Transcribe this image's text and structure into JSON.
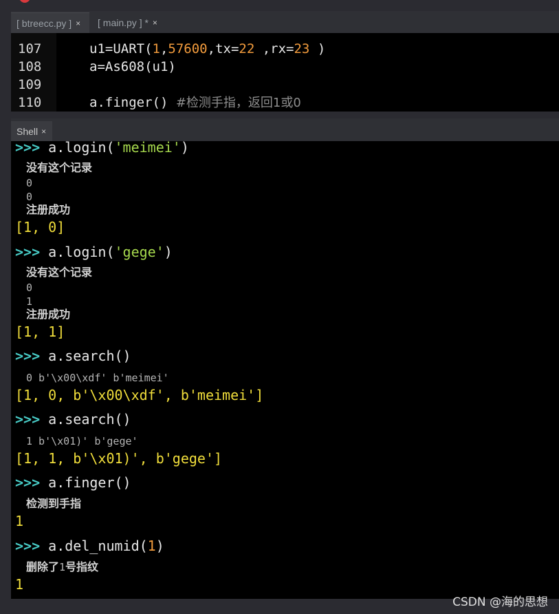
{
  "tabs": [
    {
      "label": "[ btreecc.py ]",
      "close": "×"
    },
    {
      "label": "[ main.py ] *",
      "close": "×"
    }
  ],
  "editor": {
    "lines": [
      {
        "num": "107",
        "pre": "u1=UART(",
        "n1": "1",
        "c1": ",",
        "n2": "57600",
        "c2": ",tx=",
        "n3": "22",
        "c3": " ,rx=",
        "n4": "23",
        "c4": " )"
      },
      {
        "num": "108",
        "code": "a=As608(u1)"
      },
      {
        "num": "109",
        "code": ""
      },
      {
        "num": "110",
        "code": "a.finger() ",
        "comment": "#检测手指，返回1或0"
      }
    ]
  },
  "shell": {
    "tab_label": "Shell",
    "tab_close": "×",
    "prompt_symbol": ">>>",
    "blocks": {
      "p1": {
        "cmd_pre": " a.login(",
        "cmd_str": "'meimei'",
        "cmd_post": ")"
      },
      "p1_out": [
        "没有这个记录",
        "0",
        "0",
        "注册成功"
      ],
      "p1_res": "[1, 0]",
      "p2": {
        "cmd_pre": " a.login(",
        "cmd_str": "'gege'",
        "cmd_post": ")"
      },
      "p2_out": [
        "没有这个记录",
        "0",
        "1",
        "注册成功"
      ],
      "p2_res": "[1, 1]",
      "p3": {
        "cmd": " a.search()"
      },
      "p3_out": "0 b'\\x00\\xdf' b'meimei'",
      "p3_res": "[1, 0, b'\\x00\\xdf', b'meimei']",
      "p4": {
        "cmd": " a.search()"
      },
      "p4_out": "1 b'\\x01)' b'gege'",
      "p4_res": "[1, 1, b'\\x01)', b'gege']",
      "p5": {
        "cmd": " a.finger()"
      },
      "p5_out": "检测到手指",
      "p5_res": "1",
      "p6": {
        "cmd_pre": " a.del_numid(",
        "cmd_num": "1",
        "cmd_post": ")"
      },
      "p6_out_pre": "删除了",
      "p6_out_num": "1",
      "p6_out_post": "号指纹",
      "p6_res": "1"
    }
  },
  "watermark": "CSDN @海的思想",
  "colors": {
    "prompt": "#47c9c4",
    "string": "#a6d84d",
    "number": "#f39c3d",
    "result": "#f1de3b",
    "background": "#000000"
  }
}
